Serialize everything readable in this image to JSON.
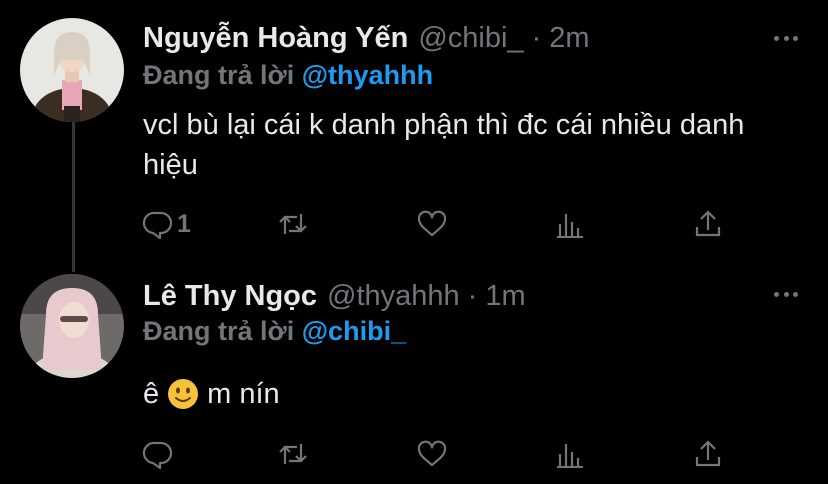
{
  "tweets": [
    {
      "display_name": "Nguyễn Hoàng Yến",
      "handle": "@chibi_",
      "separator": "·",
      "time": "2m",
      "reply_prefix": "Đang trả lời",
      "reply_mention": "@thyahhh",
      "text": "vcl bù lại cái k danh phận thì đc cái nhiều danh hiệu",
      "reply_count": "1",
      "avatar": "profile-photo-girl-brown-jacket"
    },
    {
      "display_name": "Lê Thy Ngọc",
      "handle": "@thyahhh",
      "separator": "·",
      "time": "1m",
      "reply_prefix": "Đang trả lời",
      "reply_mention": "@chibi_",
      "text_before_emoji": "ê",
      "emoji": "slightly-smiling-face",
      "text_after_emoji": "m nín",
      "reply_count": "",
      "avatar": "profile-photo-girl-pink-hair"
    }
  ],
  "colors": {
    "background": "#000000",
    "primary_text": "#e7e9ea",
    "secondary_text": "#71767b",
    "accent": "#1d9bf0",
    "thread_line": "#333639"
  },
  "icons": [
    "reply-icon",
    "retweet-icon",
    "like-icon",
    "stats-icon",
    "share-icon",
    "more-icon"
  ]
}
